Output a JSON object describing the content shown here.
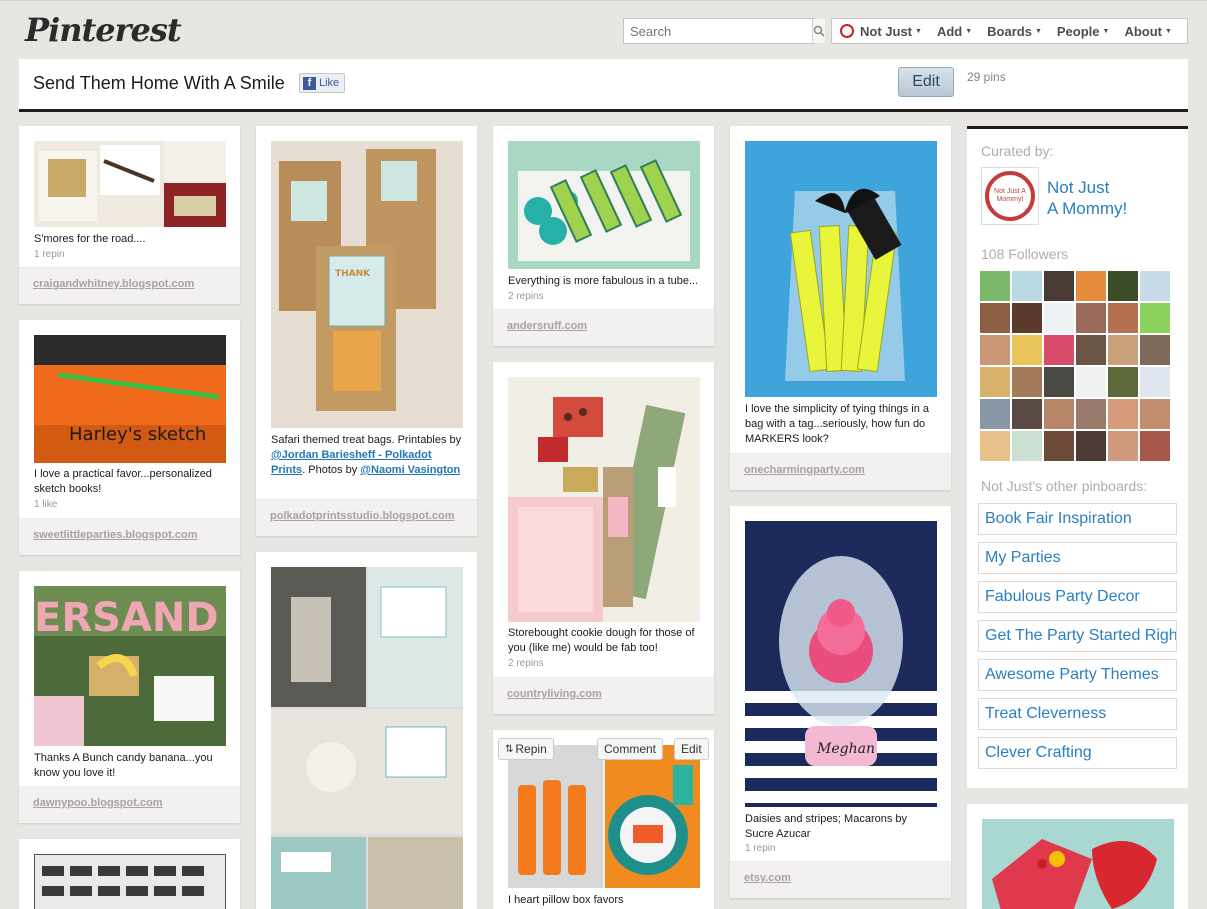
{
  "header": {
    "logo": "Pinterest",
    "search_placeholder": "Search",
    "nav": [
      {
        "label": "Not Just"
      },
      {
        "label": "Add"
      },
      {
        "label": "Boards"
      },
      {
        "label": "People"
      },
      {
        "label": "About"
      }
    ]
  },
  "board": {
    "title": "Send Them Home With A Smile",
    "like_label": "Like",
    "edit_label": "Edit",
    "pin_count": "29 pins"
  },
  "pins": {
    "p1": {
      "caption": "S'mores for the road....",
      "stat": "1 repin",
      "source": "craigandwhitney.blogspot.com"
    },
    "p2": {
      "caption": "I love a practical favor...personalized sketch books!",
      "stat": "1 like",
      "source": "sweetlittleparties.blogspot.com"
    },
    "p3": {
      "caption": "Thanks A Bunch candy banana...you know you love it!",
      "source": "dawnypoo.blogspot.com"
    },
    "p5": {
      "caption_pre": "Safari themed treat bags. Printables by ",
      "link1": "@Jordan Bariesheff - Polkadot Prints",
      "caption_mid": ". Photos by ",
      "link2": "@Naomi Vasington",
      "source": "polkadotprintsstudio.blogspot.com"
    },
    "p7": {
      "caption": "Everything is more fabulous in a tube...",
      "stat": "2 repins",
      "source": "andersruff.com"
    },
    "p8": {
      "caption": "Storebought cookie dough for those of you (like me) would be fab too!",
      "stat": "2 repins",
      "source": "countryliving.com"
    },
    "p9": {
      "caption": "I heart pillow box favors",
      "repin": "Repin",
      "comment": "Comment",
      "edit": "Edit"
    },
    "p10": {
      "caption": "I love the simplicity of tying things in a bag with a tag...seriously, how fun do MARKERS look?",
      "source": "onecharmingparty.com"
    },
    "p11": {
      "caption": "Daisies and stripes; Macarons by Sucre Azucar",
      "stat": "1 repin",
      "source": "etsy.com"
    }
  },
  "sidebar": {
    "curated_by": "Curated by:",
    "curator_line1": "Not Just",
    "curator_line2": "A Mommy!",
    "avatar_text": "Not Just A Mommy!",
    "followers_count": "108 Followers",
    "other_boards_label": "Not Just's other pinboards:",
    "boards": [
      "Book Fair Inspiration",
      "My Parties",
      "Fabulous Party Decor",
      "Get The Party Started Right",
      "Awesome Party Themes",
      "Treat Cleverness",
      "Clever Crafting"
    ]
  },
  "colors": {
    "accent": "#cb2027",
    "link": "#2a7fc1",
    "background": "#e8e6e3"
  }
}
